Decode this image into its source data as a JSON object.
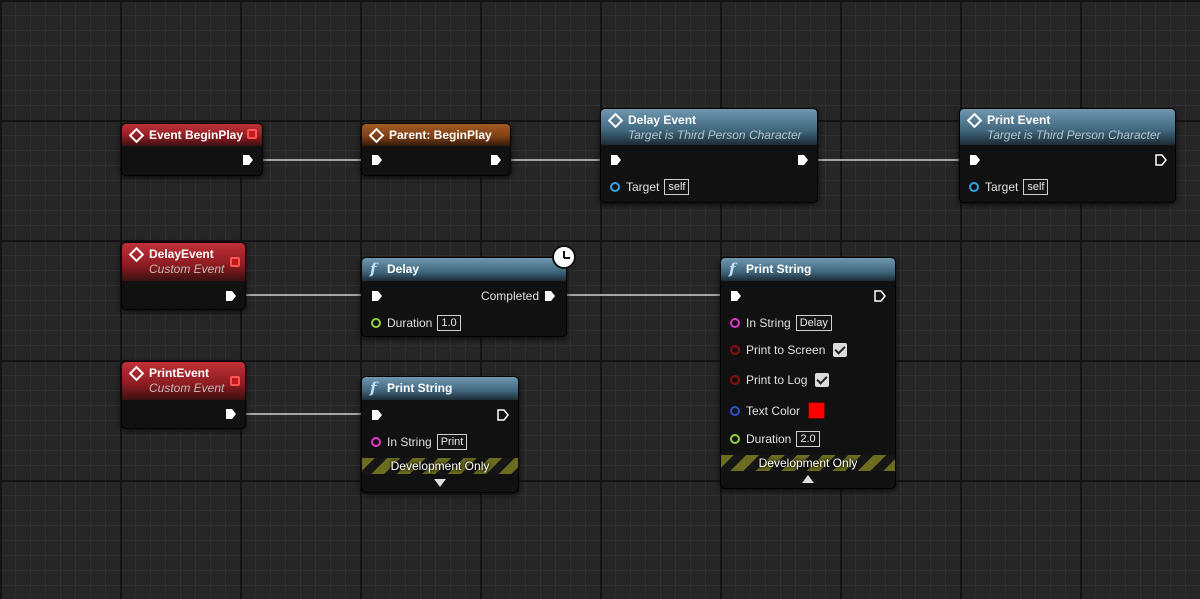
{
  "nodes": {
    "event_beginplay": {
      "title": "Event BeginPlay"
    },
    "parent_beginplay": {
      "title": "Parent: BeginPlay"
    },
    "delay_event_call": {
      "title": "Delay Event",
      "subtitle": "Target is Third Person Character",
      "target_label": "Target",
      "target_value": "self"
    },
    "print_event_call": {
      "title": "Print Event",
      "subtitle": "Target is Third Person Character",
      "target_label": "Target",
      "target_value": "self"
    },
    "custom_delay_event": {
      "title": "DelayEvent",
      "subtitle": "Custom Event"
    },
    "custom_print_event": {
      "title": "PrintEvent",
      "subtitle": "Custom Event"
    },
    "delay_function": {
      "title": "Delay",
      "completed_label": "Completed",
      "duration_label": "Duration",
      "duration_value": "1.0"
    },
    "print_string_small": {
      "title": "Print String",
      "in_string_label": "In String",
      "in_string_value": "Print",
      "dev_only": "Development Only"
    },
    "print_string_large": {
      "title": "Print String",
      "in_string_label": "In String",
      "in_string_value": "Delay",
      "print_to_screen_label": "Print to Screen",
      "print_to_screen": true,
      "print_to_log_label": "Print to Log",
      "print_to_log": true,
      "text_color_label": "Text Color",
      "text_color": "#ff0000",
      "duration_label": "Duration",
      "duration_value": "2.0",
      "dev_only": "Development Only"
    }
  },
  "icons": {
    "event": "event-diamond-icon",
    "function": "function-f-icon",
    "exec": "exec-pin-arrow-icon",
    "latent": "clock-icon"
  },
  "colors": {
    "event_header": "#a8252c",
    "parent_header": "#8a4a1c",
    "function_header": "#4f7890",
    "wire_exec": "#cfcfcf"
  }
}
